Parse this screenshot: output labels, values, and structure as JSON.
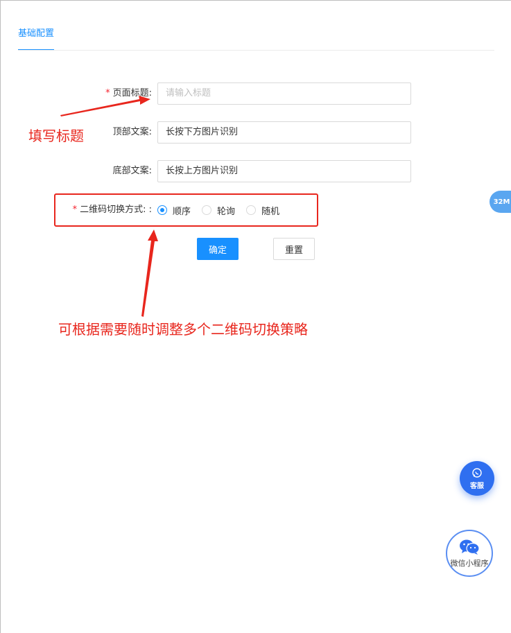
{
  "tabs": [
    {
      "label": "基础配置",
      "active": true
    }
  ],
  "form": {
    "title": {
      "label": "页面标题:",
      "required": true,
      "placeholder": "请输入标题",
      "value": ""
    },
    "top_text": {
      "label": "顶部文案:",
      "value": "长按下方图片识别"
    },
    "bottom_text": {
      "label": "底部文案:",
      "value": "长按上方图片识别"
    },
    "switch_mode": {
      "label": "二维码切换方式: :",
      "required": true,
      "options": [
        {
          "label": "顺序",
          "checked": true
        },
        {
          "label": "轮询",
          "checked": false
        },
        {
          "label": "随机",
          "checked": false
        }
      ]
    },
    "confirm_label": "确定",
    "reset_label": "重置"
  },
  "annotations": {
    "title_note": "填写标题",
    "switch_note": "可根据需要随时调整多个二维码切换策略",
    "color": "#e8261d"
  },
  "widgets": {
    "memory_badge": "32M",
    "service_label": "客服",
    "mini_program_label": "微信小程序"
  },
  "colors": {
    "primary": "#1890ff",
    "service": "#2f6ff0",
    "annotation": "#e8261d"
  }
}
